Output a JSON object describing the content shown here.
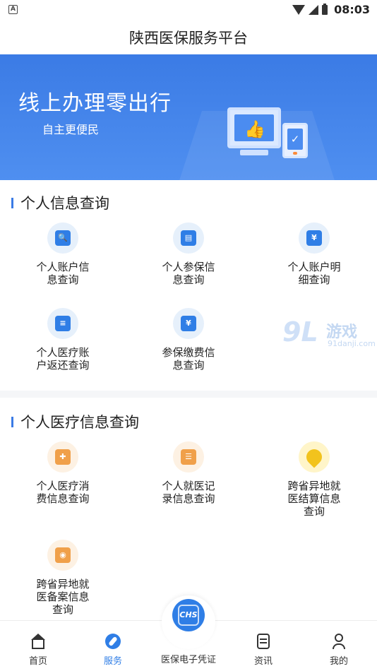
{
  "status_bar": {
    "time": "08:03",
    "left_badge": "A"
  },
  "app_title": "陕西医保服务平台",
  "banner": {
    "title": "线上办理零出行",
    "subtitle": "自主更便民"
  },
  "sections": [
    {
      "title": "个人信息查询",
      "items": [
        {
          "label": "个人账户信息查询",
          "icon": "account-search-icon",
          "glyph": "🔍"
        },
        {
          "label": "个人参保信息查询",
          "icon": "id-card-icon",
          "glyph": "▤"
        },
        {
          "label": "个人账户明细查询",
          "icon": "yuan-ledger-icon",
          "glyph": "¥"
        },
        {
          "label": "个人医疗账户返还查询",
          "icon": "document-list-icon",
          "glyph": "≡"
        },
        {
          "label": "参保缴费信息查询",
          "icon": "payment-doc-icon",
          "glyph": "¥"
        }
      ]
    },
    {
      "title": "个人医疗信息查询",
      "items": [
        {
          "label": "个人医疗消费信息查询",
          "icon": "medical-consume-icon",
          "glyph": "✚"
        },
        {
          "label": "个人就医记录信息查询",
          "icon": "medical-record-icon",
          "glyph": "☰"
        },
        {
          "label": "跨省异地就医结算信息查询",
          "icon": "location-pin-icon",
          "glyph": "●"
        },
        {
          "label": "跨省异地就医备案信息查询",
          "icon": "filing-doc-icon",
          "glyph": "◉"
        }
      ]
    }
  ],
  "watermark": {
    "big": "9L",
    "text": "游戏",
    "url": "91danji.com"
  },
  "tab_bar": {
    "tabs": [
      {
        "label": "首页",
        "icon": "home-icon"
      },
      {
        "label": "服务",
        "icon": "compass-icon",
        "active": true
      },
      {
        "label": "资讯",
        "icon": "news-icon"
      },
      {
        "label": "我的",
        "icon": "profile-icon"
      }
    ],
    "center": {
      "label": "医保电子凭证",
      "badge": "CHS"
    }
  },
  "colors": {
    "primary": "#2f7ee6",
    "banner": "#3b7be5",
    "orange": "#f0a04a",
    "yellow": "#f2c31d"
  }
}
